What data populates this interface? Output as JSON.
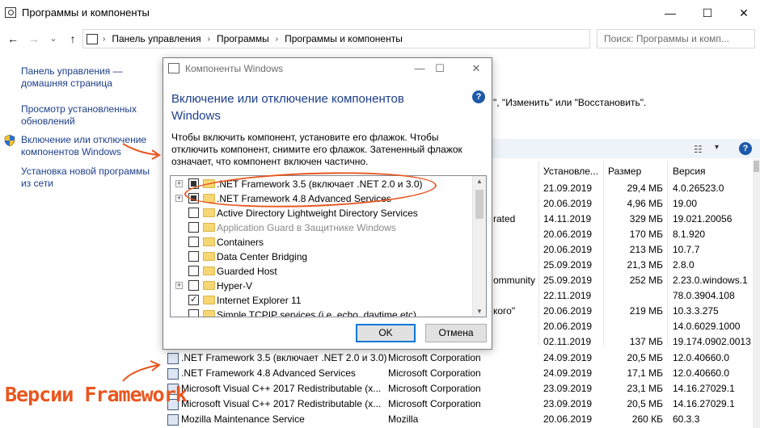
{
  "window": {
    "title": "Программы и компоненты",
    "minimize_glyph": "—",
    "maximize_glyph": "☐",
    "close_glyph": "✕"
  },
  "nav": {
    "back_glyph": "←",
    "forward_glyph": "→",
    "down_glyph": "⌄",
    "up_glyph": "↑",
    "breadcrumb": [
      "Панель управления",
      "Программы",
      "Программы и компоненты"
    ],
    "sep_glyph": "›",
    "search_placeholder": "Поиск: Программы и комп..."
  },
  "sidebar": {
    "items": [
      {
        "label": "Панель управления — домашняя страница"
      },
      {
        "label": "Просмотр установленных обновлений"
      },
      {
        "label": "Включение или отключение компонентов Windows"
      },
      {
        "label": "Установка новой программы из сети"
      }
    ]
  },
  "main": {
    "info_text": "\", \"Изменить\" или \"Восстановить\".",
    "view_glyph": "☷",
    "view_drop_glyph": "▾",
    "help_glyph": "?",
    "columns": {
      "installed": "Установле...",
      "size": "Размер",
      "version": "Версия"
    },
    "partial_rows": [
      {
        "publisher": "",
        "installed": "21.09.2019",
        "size": "29,4 МБ",
        "version": "4.0.26523.0"
      },
      {
        "publisher": "",
        "installed": "20.06.2019",
        "size": "4,96 МБ",
        "version": "19.00"
      },
      {
        "publisher": "rated",
        "installed": "14.11.2019",
        "size": "329 МБ",
        "version": "19.021.20056"
      },
      {
        "publisher": "",
        "installed": "20.06.2019",
        "size": "170 МБ",
        "version": "8.1.920"
      },
      {
        "publisher": "",
        "installed": "20.06.2019",
        "size": "213 МБ",
        "version": "10.7.7"
      },
      {
        "publisher": "",
        "installed": "25.09.2019",
        "size": "21,3 МБ",
        "version": "2.8.0"
      },
      {
        "publisher": "ommunity",
        "installed": "25.09.2019",
        "size": "252 МБ",
        "version": "2.23.0.windows.1"
      },
      {
        "publisher": "",
        "installed": "22.11.2019",
        "size": "",
        "version": "78.0.3904.108"
      },
      {
        "publisher": "кого\"",
        "installed": "20.06.2019",
        "size": "219 МБ",
        "version": "10.3.3.275"
      },
      {
        "publisher": "",
        "installed": "20.06.2019",
        "size": "",
        "version": "14.0.6029.1000"
      },
      {
        "publisher": "",
        "installed": "02.11.2019",
        "size": "137 МБ",
        "version": "19.174.0902.0013"
      }
    ],
    "full_rows": [
      {
        "name": ".NET Framework 3.5 (включает .NET 2.0 и 3.0)",
        "publisher": "Microsoft Corporation",
        "installed": "24.09.2019",
        "size": "20,5 МБ",
        "version": "12.0.40660.0"
      },
      {
        "name": ".NET Framework 4.8 Advanced Services",
        "publisher": "Microsoft Corporation",
        "installed": "24.09.2019",
        "size": "17,1 МБ",
        "version": "12.0.40660.0"
      },
      {
        "name": "Microsoft Visual C++ 2017 Redistributable (x...",
        "publisher": "Microsoft Corporation",
        "installed": "23.09.2019",
        "size": "23,1 МБ",
        "version": "14.16.27029.1"
      },
      {
        "name": "Microsoft Visual C++ 2017 Redistributable (x...",
        "publisher": "Microsoft Corporation",
        "installed": "23.09.2019",
        "size": "20,5 МБ",
        "version": "14.16.27029.1"
      },
      {
        "name": "Mozilla Maintenance Service",
        "publisher": "Mozilla",
        "installed": "20.06.2019",
        "size": "260 КБ",
        "version": "60.3.3"
      }
    ]
  },
  "dialog": {
    "title": "Компоненты Windows",
    "heading": "Включение или отключение компонентов Windows",
    "help_glyph": "?",
    "description": "Чтобы включить компонент, установите его флажок. Чтобы отключить компонент, снимите его флажок. Затененный флажок означает, что компонент включен частично.",
    "features": [
      {
        "label": ".NET Framework 3.5 (включает .NET 2.0 и 3.0)",
        "state": "partial",
        "expandable": true,
        "disabled": false
      },
      {
        "label": ".NET Framework 4.8 Advanced Services",
        "state": "partial",
        "expandable": true,
        "disabled": false
      },
      {
        "label": "Active Directory Lightweight Directory Services",
        "state": "unchecked",
        "expandable": false,
        "disabled": false
      },
      {
        "label": "Application Guard в Защитнике Windows",
        "state": "unchecked",
        "expandable": false,
        "disabled": true
      },
      {
        "label": "Containers",
        "state": "unchecked",
        "expandable": false,
        "disabled": false
      },
      {
        "label": "Data Center Bridging",
        "state": "unchecked",
        "expandable": false,
        "disabled": false
      },
      {
        "label": "Guarded Host",
        "state": "unchecked",
        "expandable": false,
        "disabled": false
      },
      {
        "label": "Hyper-V",
        "state": "unchecked",
        "expandable": true,
        "disabled": false
      },
      {
        "label": "Internet Explorer 11",
        "state": "checked",
        "expandable": false,
        "disabled": false
      },
      {
        "label": "Simple TCPIP services (i.e. echo, daytime etc)",
        "state": "unchecked",
        "expandable": false,
        "disabled": false
      }
    ],
    "expander_glyph": "+",
    "scroll_up_glyph": "▲",
    "scroll_down_glyph": "▼",
    "ok_label": "OK",
    "cancel_label": "Отмена"
  },
  "annotation": {
    "label": "Версии Framework",
    "color": "#e8561f"
  }
}
